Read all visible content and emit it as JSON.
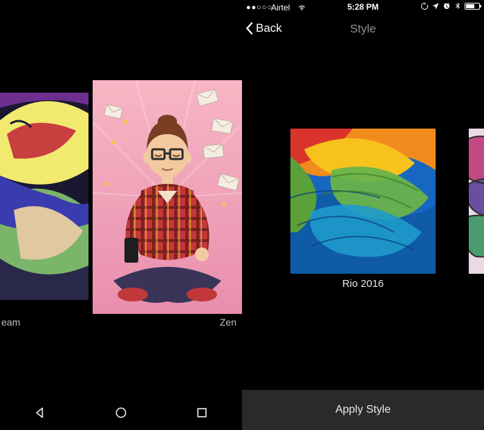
{
  "left": {
    "styles": [
      {
        "label_fragment": "eam"
      },
      {
        "label": "Zen"
      }
    ],
    "nav": {
      "back": "back-icon",
      "home": "home-icon",
      "recent": "recent-icon"
    }
  },
  "right": {
    "status": {
      "carrier": "Airtel",
      "time": "5:28 PM"
    },
    "nav": {
      "back_label": "Back",
      "title": "Style"
    },
    "carousel": {
      "selected_label": "Rio 2016"
    },
    "apply_label": "Apply Style"
  }
}
